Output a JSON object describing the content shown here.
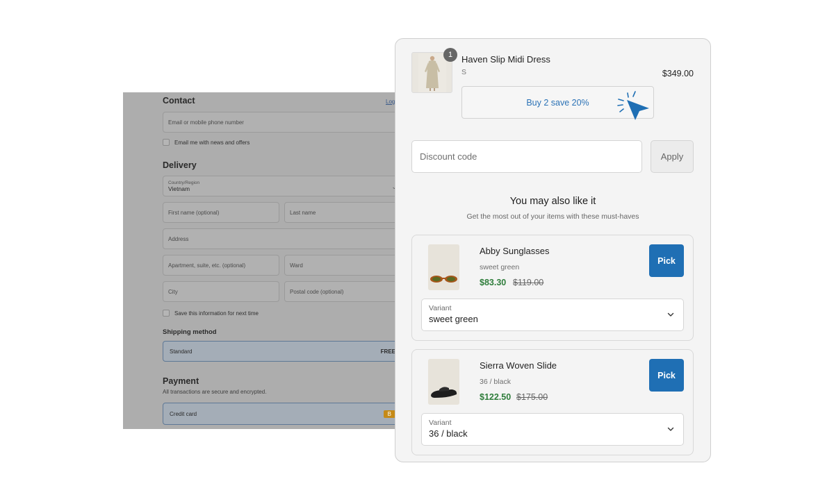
{
  "checkout": {
    "contact_heading": "Contact",
    "login_link": "Log",
    "email_placeholder": "Email or mobile phone number",
    "email_news_label": "Email me with news and offers",
    "delivery_heading": "Delivery",
    "country_label": "Country/Region",
    "country_value": "Vietnam",
    "first_name_placeholder": "First name (optional)",
    "last_name_placeholder": "Last name",
    "address_placeholder": "Address",
    "apartment_placeholder": "Apartment, suite, etc. (optional)",
    "ward_placeholder": "Ward",
    "city_placeholder": "City",
    "postal_placeholder": "Postal code (optional)",
    "save_info_label": "Save this information for next time",
    "shipping_heading": "Shipping method",
    "shipping_option": "Standard",
    "shipping_price": "FREE",
    "payment_heading": "Payment",
    "payment_sub": "All transactions are secure and encrypted.",
    "payment_option": "Credit card",
    "payment_badge": "B"
  },
  "cart": {
    "item": {
      "quantity": "1",
      "name": "Haven Slip Midi Dress",
      "variant": "S",
      "price": "$349.00"
    },
    "promo_label": "Buy 2 save 20%",
    "discount_placeholder": "Discount code",
    "apply_label": "Apply"
  },
  "recommendations": {
    "title": "You may also like it",
    "subtitle": "Get the most out of your items with these must-haves",
    "variant_label": "Variant",
    "pick_label": "Pick",
    "products": [
      {
        "name": "Abby Sunglasses",
        "variant": "sweet green",
        "price": "$83.30",
        "compare_price": "$119.00",
        "selected_variant": "sweet green"
      },
      {
        "name": "Sierra Woven Slide",
        "variant": "36 / black",
        "price": "$122.50",
        "compare_price": "$175.00",
        "selected_variant": "36 / black"
      }
    ]
  },
  "colors": {
    "accent_blue": "#1f6fb4",
    "sale_green": "#2f7d3b",
    "overlay_grey": "#adadad"
  }
}
